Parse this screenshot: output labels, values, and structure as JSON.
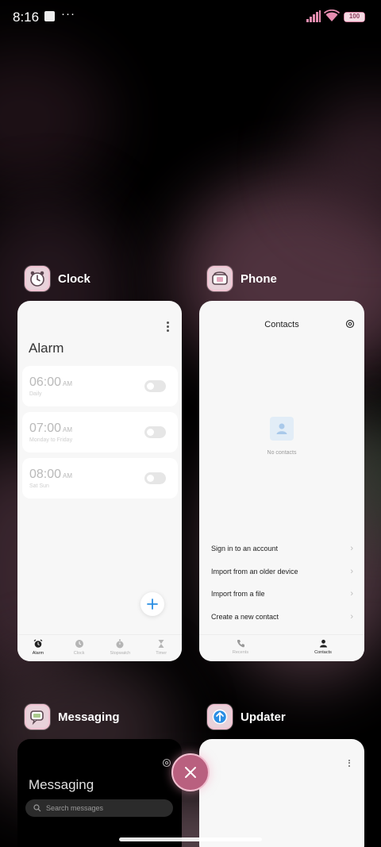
{
  "status_bar": {
    "time": "8:16",
    "battery": "100",
    "battery_level": 1.0,
    "overflow_dots": "···"
  },
  "recents": {
    "cards": [
      {
        "app": "Clock",
        "icon": "alarm-clock-icon",
        "screen": {
          "title": "Alarm",
          "alarms": [
            {
              "time": "06:00",
              "ampm": "AM",
              "repeat": "Daily",
              "enabled": false
            },
            {
              "time": "07:00",
              "ampm": "AM",
              "repeat": "Monday to Friday",
              "enabled": false
            },
            {
              "time": "08:00",
              "ampm": "AM",
              "repeat": "Sat Sun",
              "enabled": false
            }
          ],
          "tabs": [
            "Alarm",
            "Clock",
            "Stopwatch",
            "Timer"
          ],
          "active_tab": "Alarm"
        }
      },
      {
        "app": "Phone",
        "icon": "phone-icon",
        "screen": {
          "title": "Contacts",
          "empty_text": "No contacts",
          "actions": [
            "Sign in to an account",
            "Import from an older device",
            "Import from a file",
            "Create a new contact"
          ],
          "tabs": [
            "Recents",
            "Contacts"
          ],
          "active_tab": "Contacts"
        }
      },
      {
        "app": "Messaging",
        "icon": "chat-bubble-icon",
        "screen": {
          "title": "Messaging",
          "search_placeholder": "Search messages"
        }
      },
      {
        "app": "Updater",
        "icon": "update-arrow-icon",
        "screen": {}
      }
    ]
  },
  "colors": {
    "accent_pink": "#b9607f",
    "fab_plus_blue": "#2a8ee3"
  }
}
